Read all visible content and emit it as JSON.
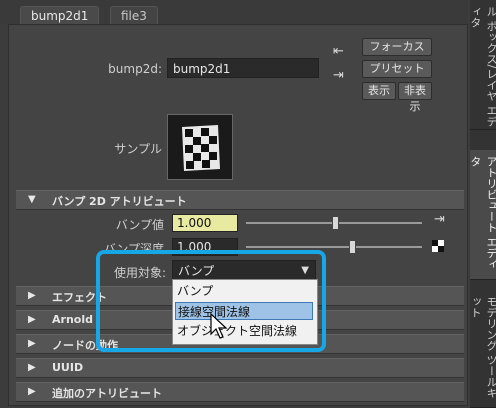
{
  "tabs": [
    "bump2d1",
    "file3"
  ],
  "node": {
    "label": "bump2d:",
    "value": "bump2d1"
  },
  "buttons": {
    "focus": "フォーカス",
    "preset": "プリセット",
    "show": "表示",
    "hide": "非表示"
  },
  "sample_label": "サンプル",
  "section_bump": "バンプ 2D アトリビュート",
  "attrs": {
    "bump_value_label": "バンプ値",
    "bump_value": "1.000",
    "bump_depth_label": "バンプ深度",
    "bump_depth": "1.000",
    "use_as_label": "使用対象:",
    "use_as_value": "バンプ"
  },
  "dropdown_options": [
    "バンプ",
    "接線空間法線",
    "オブジェクト空間法線"
  ],
  "sections": [
    "エフェクト",
    "Arnold",
    "ノードの動作",
    "UUID",
    "追加のアトリビュート"
  ],
  "side_tabs": [
    "ル ボックス/レイヤ エディタ",
    "アトリビュート エディタ",
    "モデリング ツールキット"
  ],
  "colors": {
    "highlight": "#18a7e6",
    "value_field": "#e9eaa1",
    "selected_item": "#9fc3e6"
  }
}
